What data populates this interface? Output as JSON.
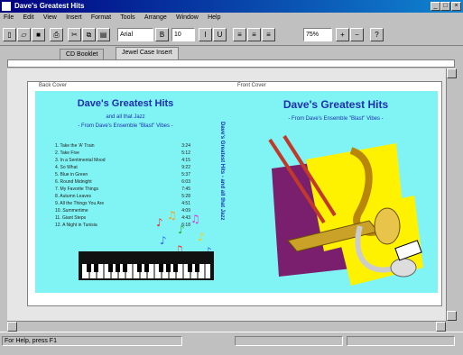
{
  "window": {
    "title": "Dave's Greatest Hits"
  },
  "menu": [
    "File",
    "Edit",
    "View",
    "Insert",
    "Format",
    "Tools",
    "Arrange",
    "Window",
    "Help"
  ],
  "toolbar": {
    "font_name": "Arial",
    "font_size": "10",
    "zoom": "75%"
  },
  "tabs": [
    "CD Booklet",
    "Jewel Case Insert"
  ],
  "left_panel": {
    "label": "Back Cover",
    "title": "Dave's Greatest Hits",
    "subtitle1": "and all that Jazz",
    "subtitle2": "- From Dave's Ensemble \"Blast\" Vibes -",
    "spine": "Dave's Greatest Hits - and all that Jazz",
    "tracks": [
      {
        "name": "1. Take the 'A' Train",
        "dur": "3:24"
      },
      {
        "name": "2. Take Five",
        "dur": "5:12"
      },
      {
        "name": "3. In a Sentimental Mood",
        "dur": "4:15"
      },
      {
        "name": "4. So What",
        "dur": "9:22"
      },
      {
        "name": "5. Blue in Green",
        "dur": "5:37"
      },
      {
        "name": "6. Round Midnight",
        "dur": "6:03"
      },
      {
        "name": "7. My Favorite Things",
        "dur": "7:45"
      },
      {
        "name": "8. Autumn Leaves",
        "dur": "5:28"
      },
      {
        "name": "9. All the Things You Are",
        "dur": "4:51"
      },
      {
        "name": "10. Summertime",
        "dur": "4:09"
      },
      {
        "name": "11. Giant Steps",
        "dur": "4:43"
      },
      {
        "name": "12. A Night in Tunisia",
        "dur": "6:18"
      }
    ]
  },
  "right_panel": {
    "label": "Front Cover",
    "title": "Dave's Greatest Hits",
    "subtitle": "- From Dave's Ensemble \"Blast\" Vibes -"
  },
  "statusbar": {
    "left": "For Help, press F1",
    "mid": "",
    "right": ""
  }
}
